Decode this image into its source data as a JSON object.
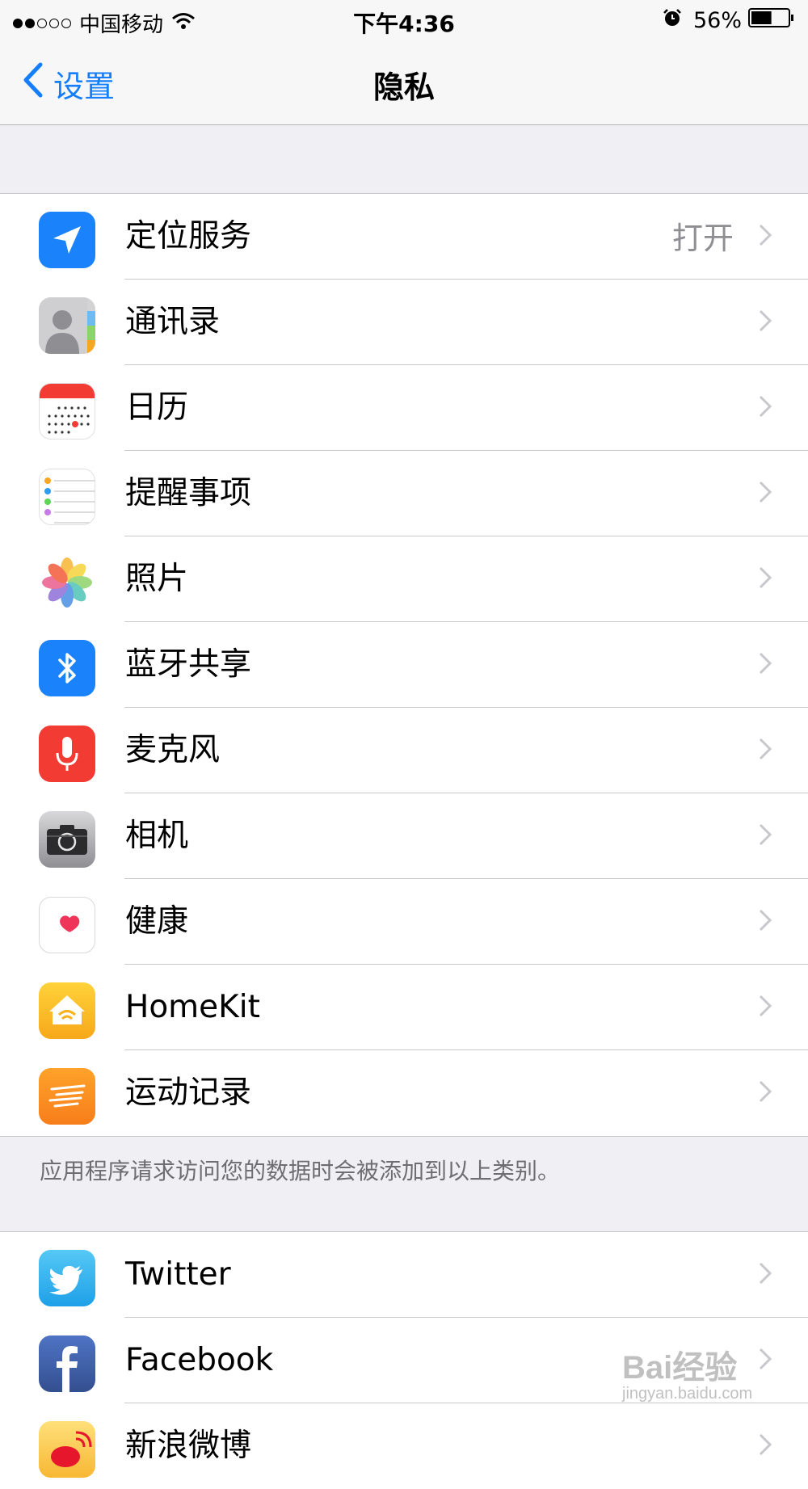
{
  "status_bar": {
    "carrier": "中国移动",
    "time": "下午4:36",
    "battery": "56%",
    "battery_level": 0.56,
    "signal_bars_filled": 2,
    "signal_bars_total": 5
  },
  "nav": {
    "back_label": "设置",
    "title": "隐私"
  },
  "privacy_items": [
    {
      "label": "定位服务",
      "value": "打开",
      "icon": "location-icon"
    },
    {
      "label": "通讯录",
      "value": "",
      "icon": "contacts-icon"
    },
    {
      "label": "日历",
      "value": "",
      "icon": "calendar-icon"
    },
    {
      "label": "提醒事项",
      "value": "",
      "icon": "reminders-icon"
    },
    {
      "label": "照片",
      "value": "",
      "icon": "photos-icon"
    },
    {
      "label": "蓝牙共享",
      "value": "",
      "icon": "bluetooth-icon"
    },
    {
      "label": "麦克风",
      "value": "",
      "icon": "microphone-icon"
    },
    {
      "label": "相机",
      "value": "",
      "icon": "camera-icon"
    },
    {
      "label": "健康",
      "value": "",
      "icon": "health-icon"
    },
    {
      "label": "HomeKit",
      "value": "",
      "icon": "homekit-icon"
    },
    {
      "label": "运动记录",
      "value": "",
      "icon": "motion-icon"
    }
  ],
  "footer_note": "应用程序请求访问您的数据时会被添加到以上类别。",
  "social_items": [
    {
      "label": "Twitter",
      "icon": "twitter-icon"
    },
    {
      "label": "Facebook",
      "icon": "facebook-icon"
    },
    {
      "label": "新浪微博",
      "icon": "weibo-icon"
    }
  ],
  "watermark": {
    "brand": "Bai经验",
    "url": "jingyan.baidu.com"
  },
  "colors": {
    "accent": "#157efb",
    "background": "#efeff4",
    "secondary_text": "#8e8e93"
  }
}
